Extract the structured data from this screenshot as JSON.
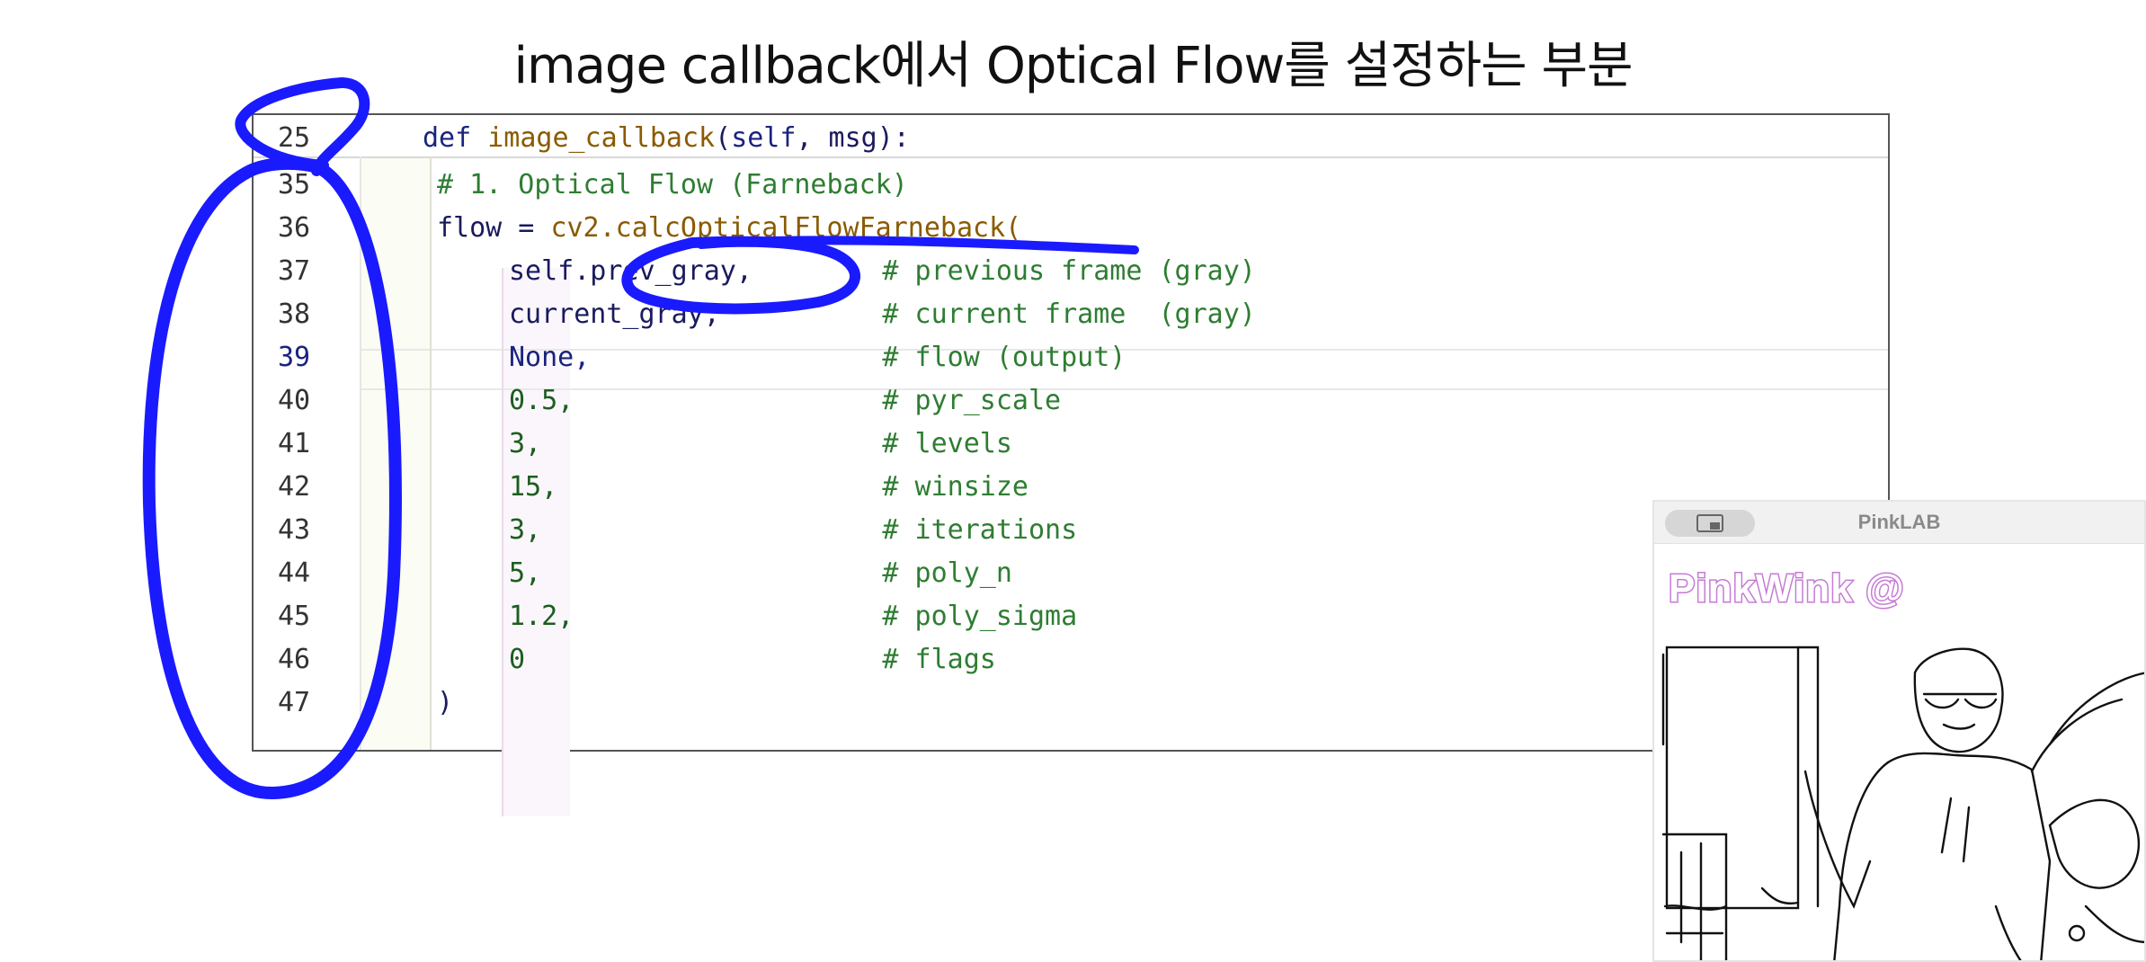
{
  "slide": {
    "title": "image callback에서 Optical Flow를 설정하는 부분"
  },
  "editor": {
    "lines": [
      {
        "num": "25",
        "indent": 0,
        "tokens": [
          {
            "t": "def ",
            "c": "kw"
          },
          {
            "t": "image_callback",
            "c": "fn"
          },
          {
            "t": "(",
            "c": "punc"
          },
          {
            "t": "self",
            "c": "kw"
          },
          {
            "t": ", msg):",
            "c": "punc"
          }
        ]
      },
      {
        "num": "35",
        "indent": 1,
        "tokens": [
          {
            "t": "# 1. Optical Flow (Farneback)",
            "c": "cm"
          }
        ]
      },
      {
        "num": "36",
        "indent": 1,
        "tokens": [
          {
            "t": "flow = ",
            "c": "punc"
          },
          {
            "t": "cv2.calcOpticalFlowFarneback(",
            "c": "fn"
          }
        ]
      },
      {
        "num": "37",
        "indent": 2,
        "tokens": [
          {
            "t": "self.prev_gray,",
            "c": "punc"
          },
          {
            "t": "        # previous frame (gray)",
            "c": "cm"
          }
        ]
      },
      {
        "num": "38",
        "indent": 2,
        "tokens": [
          {
            "t": "current_gray,",
            "c": "punc"
          },
          {
            "t": "          # current frame  (gray)",
            "c": "cm"
          }
        ]
      },
      {
        "num": "39",
        "indent": 2,
        "active": true,
        "tokens": [
          {
            "t": "None,",
            "c": "kw"
          },
          {
            "t": "                  # flow (output)",
            "c": "cm"
          }
        ]
      },
      {
        "num": "40",
        "indent": 2,
        "tokens": [
          {
            "t": "0.5,",
            "c": "num"
          },
          {
            "t": "                   # pyr_scale",
            "c": "cm"
          }
        ]
      },
      {
        "num": "41",
        "indent": 2,
        "tokens": [
          {
            "t": "3,",
            "c": "num"
          },
          {
            "t": "                     # levels",
            "c": "cm"
          }
        ]
      },
      {
        "num": "42",
        "indent": 2,
        "tokens": [
          {
            "t": "15,",
            "c": "num"
          },
          {
            "t": "                    # winsize",
            "c": "cm"
          }
        ]
      },
      {
        "num": "43",
        "indent": 2,
        "tokens": [
          {
            "t": "3,",
            "c": "num"
          },
          {
            "t": "                     # iterations",
            "c": "cm"
          }
        ]
      },
      {
        "num": "44",
        "indent": 2,
        "tokens": [
          {
            "t": "5,",
            "c": "num"
          },
          {
            "t": "                     # poly_n",
            "c": "cm"
          }
        ]
      },
      {
        "num": "45",
        "indent": 2,
        "tokens": [
          {
            "t": "1.2,",
            "c": "num"
          },
          {
            "t": "                   # poly_sigma",
            "c": "cm"
          }
        ]
      },
      {
        "num": "46",
        "indent": 2,
        "tokens": [
          {
            "t": "0",
            "c": "num"
          },
          {
            "t": "                      # flags",
            "c": "cm"
          }
        ]
      },
      {
        "num": "47",
        "indent": 1,
        "tokens": [
          {
            "t": ")",
            "c": "punc"
          }
        ]
      }
    ]
  },
  "pip": {
    "window_title": "PinkLAB",
    "brand": "PinkWink @",
    "button_icon": "picture-in-picture-icon"
  },
  "colors": {
    "annotation": "#1a1aff",
    "keyword": "#1a237e",
    "comment": "#2e7d32",
    "function": "#8a5a00",
    "brand_stroke": "#c57ad6"
  }
}
